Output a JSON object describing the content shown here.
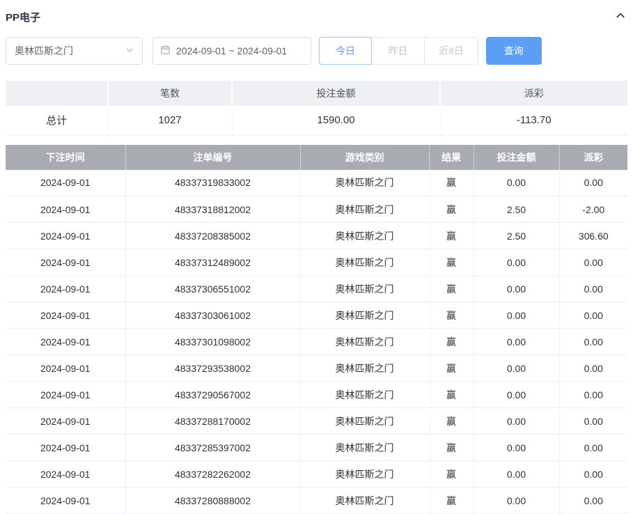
{
  "header": {
    "title": "PP电子",
    "collapse_icon": "chevron-up"
  },
  "filters": {
    "game_select": {
      "value": "奥林匹斯之门",
      "icon": "chevron-down-icon"
    },
    "date_range": {
      "value": "2024-09-01 ~ 2024-09-01",
      "icon": "calendar-icon"
    },
    "quick_buttons": [
      {
        "label": "今日",
        "active": true
      },
      {
        "label": "昨日",
        "active": false
      },
      {
        "label": "近8日",
        "active": false
      }
    ],
    "search_label": "查询"
  },
  "summary": {
    "headers": [
      "",
      "笔数",
      "投注金额",
      "派彩"
    ],
    "row": {
      "label": "总计",
      "count": "1027",
      "bet_amount": "1590.00",
      "payout": "-113.70"
    }
  },
  "table": {
    "headers": [
      "下注时间",
      "注单编号",
      "游戏类别",
      "结果",
      "投注金额",
      "派彩"
    ],
    "rows": [
      {
        "time": "2024-09-01",
        "order_id": "48337319833002",
        "game": "奥林匹斯之门",
        "result": "赢",
        "bet": "0.00",
        "payout": "0.00"
      },
      {
        "time": "2024-09-01",
        "order_id": "48337318812002",
        "game": "奥林匹斯之门",
        "result": "赢",
        "bet": "2.50",
        "payout": "-2.00"
      },
      {
        "time": "2024-09-01",
        "order_id": "48337208385002",
        "game": "奥林匹斯之门",
        "result": "赢",
        "bet": "2.50",
        "payout": "306.60"
      },
      {
        "time": "2024-09-01",
        "order_id": "48337312489002",
        "game": "奥林匹斯之门",
        "result": "赢",
        "bet": "0.00",
        "payout": "0.00"
      },
      {
        "time": "2024-09-01",
        "order_id": "48337306551002",
        "game": "奥林匹斯之门",
        "result": "赢",
        "bet": "0.00",
        "payout": "0.00"
      },
      {
        "time": "2024-09-01",
        "order_id": "48337303061002",
        "game": "奥林匹斯之门",
        "result": "赢",
        "bet": "0.00",
        "payout": "0.00"
      },
      {
        "time": "2024-09-01",
        "order_id": "48337301098002",
        "game": "奥林匹斯之门",
        "result": "赢",
        "bet": "0.00",
        "payout": "0.00"
      },
      {
        "time": "2024-09-01",
        "order_id": "48337293538002",
        "game": "奥林匹斯之门",
        "result": "赢",
        "bet": "0.00",
        "payout": "0.00"
      },
      {
        "time": "2024-09-01",
        "order_id": "48337290567002",
        "game": "奥林匹斯之门",
        "result": "赢",
        "bet": "0.00",
        "payout": "0.00"
      },
      {
        "time": "2024-09-01",
        "order_id": "48337288170002",
        "game": "奥林匹斯之门",
        "result": "赢",
        "bet": "0.00",
        "payout": "0.00"
      },
      {
        "time": "2024-09-01",
        "order_id": "48337285397002",
        "game": "奥林匹斯之门",
        "result": "赢",
        "bet": "0.00",
        "payout": "0.00"
      },
      {
        "time": "2024-09-01",
        "order_id": "48337282262002",
        "game": "奥林匹斯之门",
        "result": "赢",
        "bet": "0.00",
        "payout": "0.00"
      },
      {
        "time": "2024-09-01",
        "order_id": "48337280888002",
        "game": "奥林匹斯之门",
        "result": "赢",
        "bet": "0.00",
        "payout": "0.00"
      }
    ]
  },
  "colors": {
    "accent": "#5c9df5",
    "negative": "#f56c6c",
    "table_header_bg": "#a8abb2",
    "summary_header_bg": "#eef0f3"
  }
}
